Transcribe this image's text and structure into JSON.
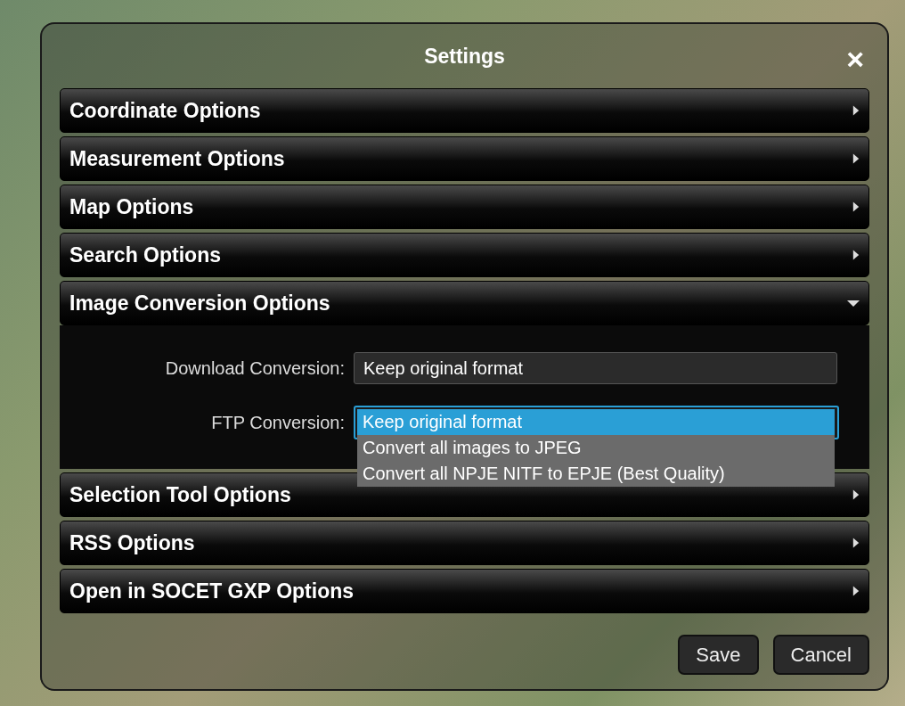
{
  "dialog": {
    "title": "Settings",
    "close": "×"
  },
  "sections": [
    {
      "title": "Coordinate Options",
      "expanded": false
    },
    {
      "title": "Measurement Options",
      "expanded": false
    },
    {
      "title": "Map Options",
      "expanded": false
    },
    {
      "title": "Search Options",
      "expanded": false
    },
    {
      "title": "Image Conversion Options",
      "expanded": true,
      "fields": [
        {
          "label": "Download Conversion:",
          "value": "Keep original format",
          "open": false
        },
        {
          "label": "FTP Conversion:",
          "open": true,
          "options": [
            {
              "label": "Keep original format",
              "selected": true
            },
            {
              "label": "Convert all images to JPEG",
              "selected": false
            },
            {
              "label": "Convert all NPJE NITF to EPJE (Best Quality)",
              "selected": false
            }
          ]
        }
      ]
    },
    {
      "title": "Selection Tool Options",
      "expanded": false
    },
    {
      "title": "RSS Options",
      "expanded": false
    },
    {
      "title": "Open in SOCET GXP Options",
      "expanded": false
    }
  ],
  "buttons": [
    "Save",
    "Cancel"
  ]
}
